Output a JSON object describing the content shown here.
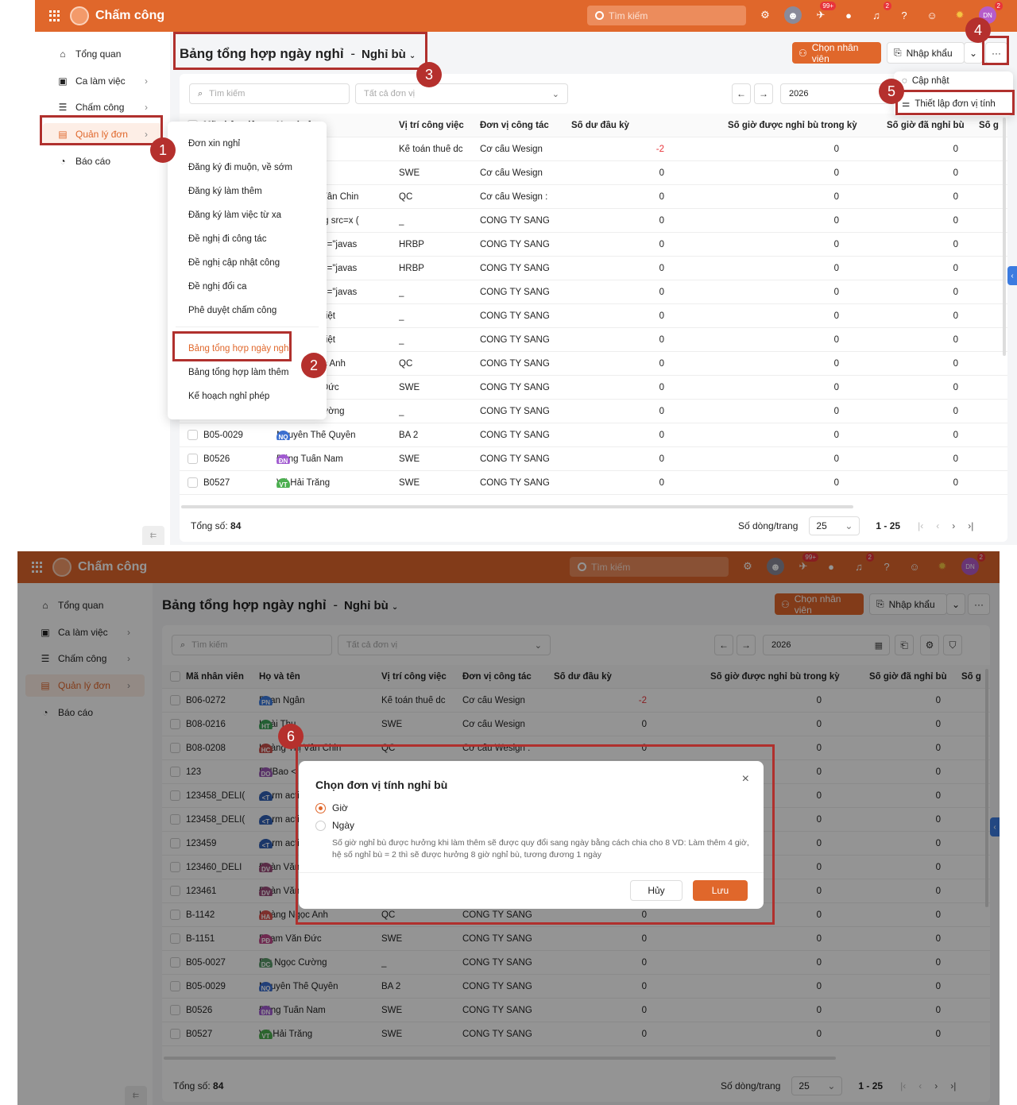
{
  "app": {
    "name": "Chấm công",
    "search_placeholder": "Tìm kiếm",
    "notif_badge": "99+",
    "bell_badge": "2",
    "avatar_badge": "2",
    "avatar": "DN"
  },
  "sidebar": [
    {
      "icon": "home-icon",
      "glyph": "⌂",
      "label": "Tổng quan"
    },
    {
      "icon": "calendar-icon",
      "glyph": "▣",
      "label": "Ca làm việc"
    },
    {
      "icon": "list-icon",
      "glyph": "☰",
      "label": "Chấm công"
    },
    {
      "icon": "document-icon",
      "glyph": "▤",
      "label": "Quản lý đơn"
    },
    {
      "icon": "pie-chart-icon",
      "glyph": "◔",
      "label": "Báo cáo"
    }
  ],
  "page": {
    "title": "Bảng tổng hợp ngày nghỉ",
    "sep": "-",
    "subtitle": "Nghỉ bù"
  },
  "buttons": {
    "choose_employee": "Chọn nhân viên",
    "import": "Nhập khẩu",
    "more": "···"
  },
  "filters": {
    "search_placeholder": "Tìm kiếm",
    "unit_placeholder": "Tất cả đơn vị",
    "year": "2026"
  },
  "columns": [
    "Mã nhân viên",
    "Họ và tên",
    "Vị trí công việc",
    "Đơn vị công tác",
    "Số dư đầu kỳ",
    "Số giờ được nghỉ bù trong kỳ",
    "Số giờ đã nghỉ bù",
    "Số g"
  ],
  "rows": [
    {
      "id": "B06-0272",
      "initials": "PN",
      "color": "#3b7be0",
      "name": "Phan Ngân",
      "pos": "Kế toán thuế dc",
      "unit": "Cơ cấu Wesign",
      "bal": "-2",
      "earned": "0",
      "used": "0"
    },
    {
      "id": "B08-0216",
      "initials": "HT",
      "color": "#3fa45a",
      "name": "Hoài Thu",
      "pos": "SWE",
      "unit": "Cơ cấu Wesign",
      "bal": "0",
      "earned": "0",
      "used": "0"
    },
    {
      "id": "B08-0208",
      "initials": "HC",
      "color": "#c8504a",
      "name": "Hoàng Thị Vân Chin",
      "pos": "QC",
      "unit": "Cơ cấu Wesign :",
      "bal": "0",
      "earned": "0",
      "used": "0"
    },
    {
      "id": "123",
      "initials": "DO",
      "color": "#9b59b6",
      "name": "DHBao <img src=x (",
      "pos": "_",
      "unit": "CÔNG TY SÁNG",
      "bal": "0",
      "earned": "0",
      "used": "0"
    },
    {
      "id": "123458_DELI(",
      "initials": "<T",
      "color": "#2f5fb5",
      "name": "<form action=\"javas",
      "pos": "HRBP",
      "unit": "CÔNG TY SÁNG",
      "bal": "0",
      "earned": "0",
      "used": "0"
    },
    {
      "id": "123458_DELI(",
      "initials": "<T",
      "color": "#2f5fb5",
      "name": "<form action=\"javas",
      "pos": "HRBP",
      "unit": "CÔNG TY SÁNG",
      "bal": "0",
      "earned": "0",
      "used": "0"
    },
    {
      "id": "123459",
      "initials": "<T",
      "color": "#2f5fb5",
      "name": "<form action=\"javas",
      "pos": "_",
      "unit": "CÔNG TY SÁNG",
      "bal": "0",
      "earned": "0",
      "used": "0"
    },
    {
      "id": "123460_DELI",
      "initials": "DV",
      "color": "#9b4c7a",
      "name": "Đoàn Văn Việt",
      "pos": "_",
      "unit": "CÔNG TY SÁNG",
      "bal": "0",
      "earned": "0",
      "used": "0"
    },
    {
      "id": "123461",
      "initials": "DV",
      "color": "#9b4c7a",
      "name": "Đoàn Văn Việt",
      "pos": "_",
      "unit": "CÔNG TY SÁNG",
      "bal": "0",
      "earned": "0",
      "used": "0"
    },
    {
      "id": "B-1142",
      "initials": "HA",
      "color": "#d9534f",
      "name": "Hoàng Ngọc Anh",
      "pos": "QC",
      "unit": "CÔNG TY SÁNG",
      "bal": "0",
      "earned": "0",
      "used": "0"
    },
    {
      "id": "B-1151",
      "initials": "PĐ",
      "color": "#c0478a",
      "name": "Phạm Văn Đức",
      "pos": "SWE",
      "unit": "CÔNG TY SÁNG",
      "bal": "0",
      "earned": "0",
      "used": "0"
    },
    {
      "id": "B05-0027",
      "initials": "DC",
      "color": "#5a9a6a",
      "name": "Dư Ngọc Cường",
      "pos": "_",
      "unit": "CÔNG TY SÁNG",
      "bal": "0",
      "earned": "0",
      "used": "0"
    },
    {
      "id": "B05-0029",
      "initials": "NQ",
      "color": "#3b6fd0",
      "name": "Nguyễn Thế Quyền",
      "pos": "BA 2",
      "unit": "CÔNG TY SÁNG",
      "bal": "0",
      "earned": "0",
      "used": "0"
    },
    {
      "id": "B0526",
      "initials": "ĐN",
      "color": "#a05ad0",
      "name": "Đặng Tuấn Nam",
      "pos": "SWE",
      "unit": "CÔNG TY SÁNG",
      "bal": "0",
      "earned": "0",
      "used": "0"
    },
    {
      "id": "B0527",
      "initials": "VT",
      "color": "#4caf50",
      "name": "Vũ Hải Trắng",
      "pos": "SWE",
      "unit": "CÔNG TY SÁNG",
      "bal": "0",
      "earned": "0",
      "used": "0"
    }
  ],
  "footer": {
    "total_label": "Tổng số:",
    "total": "84",
    "rows_per_page_label": "Số dòng/trang",
    "rows_per_page": "25",
    "range": "1 - 25"
  },
  "dropdown_menu": [
    "Đơn xin nghỉ",
    "Đăng ký đi muộn, về sớm",
    "Đăng ký làm thêm",
    "Đăng ký làm việc từ xa",
    "Đề nghị đi công tác",
    "Đề nghị cập nhật công",
    "Đề nghị đổi ca",
    "Phê duyệt chấm công",
    "Bảng tổng hợp ngày nghỉ",
    "Bảng tổng hợp làm thêm",
    "Kế hoạch nghỉ phép"
  ],
  "more_menu": {
    "refresh": "Cập nhật",
    "unit_setting": "Thiết lập đơn vị tính"
  },
  "modal": {
    "title": "Chọn đơn vị tính nghỉ bù",
    "option_hour": "Giờ",
    "option_day": "Ngày",
    "note": "Số giờ nghỉ bù được hưởng khi làm thêm sẽ được quy đổi sang ngày bằng cách chia cho 8 VD: Làm thêm 4 giờ, hệ số nghỉ bù = 2 thì sẽ được hưởng 8 giờ nghỉ bù, tương đương 1 ngày",
    "cancel": "Hủy",
    "save": "Lưu",
    "selected": "Giờ"
  },
  "steps": [
    "1",
    "2",
    "3",
    "4",
    "5",
    "6"
  ],
  "colors": {
    "brand": "#e0672b",
    "annotation": "#b5302d"
  }
}
